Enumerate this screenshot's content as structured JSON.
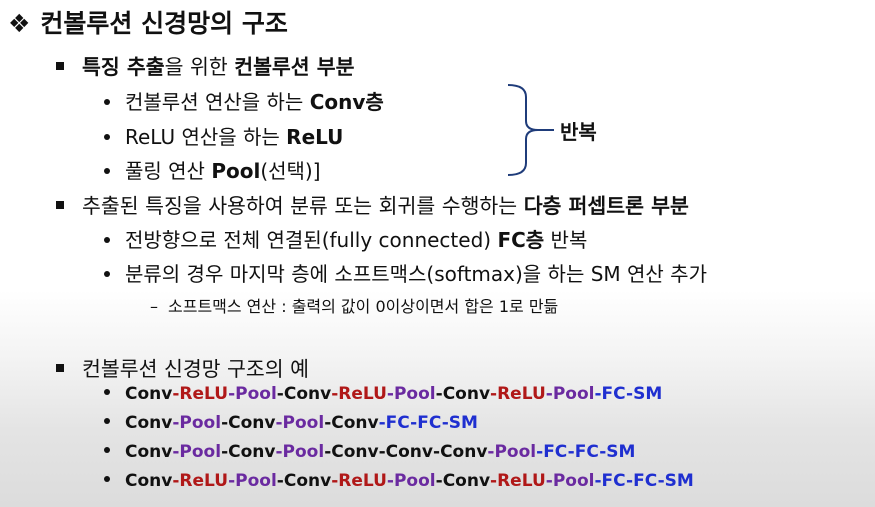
{
  "title": {
    "bullet": "❖",
    "text": "컨볼루션 신경망의 구조"
  },
  "sec1": {
    "bold1": "특징 추출",
    "mid": "을 위한 ",
    "bold2": "컨볼루션 부분"
  },
  "sec1_items": [
    {
      "pre": "컨볼루션 연산을 하는 ",
      "bold": "Conv층",
      "post": ""
    },
    {
      "pre": "ReLU 연산을 하는 ",
      "bold": "ReLU",
      "post": ""
    },
    {
      "pre": "풀링 연산 ",
      "bold": "Pool",
      "post": "(선택)]"
    }
  ],
  "repeat_label": "반복",
  "sec2": {
    "pre": "추출된 특징을 사용하여 분류 또는 회귀를 수행하는 ",
    "bold": "다층 퍼셉트론 부분"
  },
  "sec2_items": [
    {
      "pre": "전방향으로 전체 연결된(fully connected) ",
      "bold": "FC층",
      "post": " 반복"
    },
    {
      "pre": "분류의 경우 마지막 층에 소프트맥스(softmax)을 하는 SM 연산 추가",
      "bold": "",
      "post": ""
    }
  ],
  "sec2_sub": {
    "dash": "–",
    "text": "소프트맥스 연산 : 출력의 값이 0이상이면서 합은 1로 만듦"
  },
  "sec3": {
    "text": "컨볼루션 신경망 구조의 예"
  },
  "colors": {
    "relu": "#b01818",
    "pool": "#6a2aa0",
    "fc": "#1f2fd0",
    "conv": "#111111"
  },
  "examples": [
    [
      "Conv",
      "-",
      "ReLU",
      "-",
      "Pool",
      "-",
      "Conv",
      "-",
      "ReLU",
      "-",
      "Pool",
      "-",
      "Conv",
      "-",
      "ReLU",
      "-",
      "Pool",
      "-",
      "FC",
      "-",
      "SM"
    ],
    [
      "Conv",
      "-",
      "Pool",
      "-",
      "Conv",
      "-",
      "Pool",
      "-",
      "Conv",
      "-",
      "FC",
      "-",
      "FC",
      "-",
      "SM"
    ],
    [
      "Conv",
      "-",
      "Pool",
      "-",
      "Conv",
      "-",
      "Pool",
      "-",
      "Conv",
      "-",
      "Conv",
      "-",
      "Conv",
      "-",
      "Pool",
      "-",
      "FC",
      "-",
      "FC",
      "-",
      "SM"
    ],
    [
      "Conv",
      "-",
      "ReLU",
      "-",
      "Pool",
      "-",
      "Conv",
      "-",
      "ReLU",
      "-",
      "Pool",
      "-",
      "Conv",
      "-",
      "ReLU",
      "-",
      "Pool",
      "-",
      "FC",
      "-",
      "FC",
      "-",
      "SM"
    ]
  ]
}
